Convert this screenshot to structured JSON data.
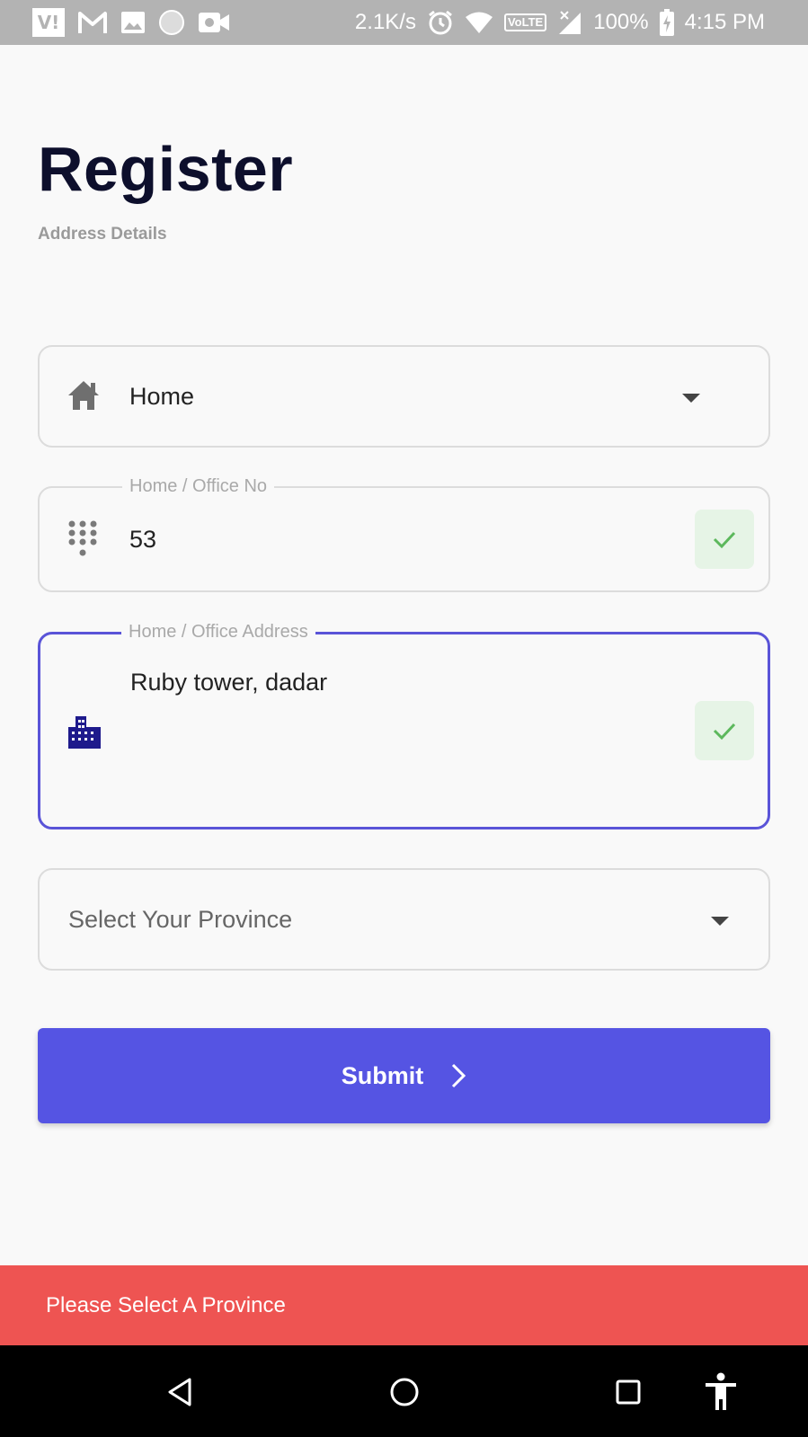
{
  "status_bar": {
    "carrier_badge": "V!",
    "speed": "2.1K/s",
    "volte": "VoLTE",
    "battery": "100%",
    "time": "4:15 PM",
    "icons": [
      "gmail-icon",
      "image-icon",
      "circle-icon",
      "video-icon",
      "alarm-icon",
      "wifi-icon",
      "signal-icon",
      "battery-charging-icon"
    ]
  },
  "header": {
    "title": "Register",
    "subtitle": "Address Details"
  },
  "form": {
    "address_type": {
      "value": "Home",
      "icon": "home-icon"
    },
    "office_no": {
      "label": "Home / Office No",
      "value": "53",
      "icon": "dialpad-icon",
      "valid": true
    },
    "address": {
      "label": "Home / Office Address",
      "value": "Ruby tower, dadar",
      "icon": "apartment-icon",
      "valid": true
    },
    "province": {
      "placeholder": "Select Your Province"
    }
  },
  "submit": {
    "label": "Submit",
    "icon": "chevron-right-icon"
  },
  "snackbar": {
    "message": "Please Select A Province"
  },
  "nav_bar": {
    "icons": [
      "back-icon",
      "home-circle-icon",
      "recents-icon",
      "accessibility-icon"
    ]
  },
  "colors": {
    "accent": "#5554e3",
    "title": "#0d0f2c",
    "error": "#ee5452",
    "success": "#4caf50"
  }
}
